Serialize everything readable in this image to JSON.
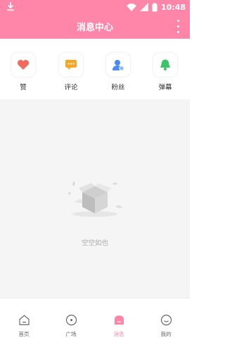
{
  "status_bar": {
    "time": "10:48"
  },
  "header": {
    "title": "消息中心"
  },
  "quick_actions": [
    {
      "label": "赞",
      "icon": "heart-icon",
      "color": "#f2695e"
    },
    {
      "label": "评论",
      "icon": "comment-icon",
      "color": "#f5a623"
    },
    {
      "label": "粉丝",
      "icon": "fans-icon",
      "color": "#4a8af4"
    },
    {
      "label": "弹幕",
      "icon": "bell-icon",
      "color": "#3cc46b"
    }
  ],
  "empty_state": {
    "text": "空空如也"
  },
  "tabs": [
    {
      "label": "首页",
      "icon": "home-icon"
    },
    {
      "label": "广场",
      "icon": "plaza-icon"
    },
    {
      "label": "消息",
      "icon": "message-icon",
      "active": true
    },
    {
      "label": "我的",
      "icon": "profile-icon"
    }
  ],
  "colors": {
    "brand": "#ff86a9",
    "background": "#f5f5f5"
  }
}
